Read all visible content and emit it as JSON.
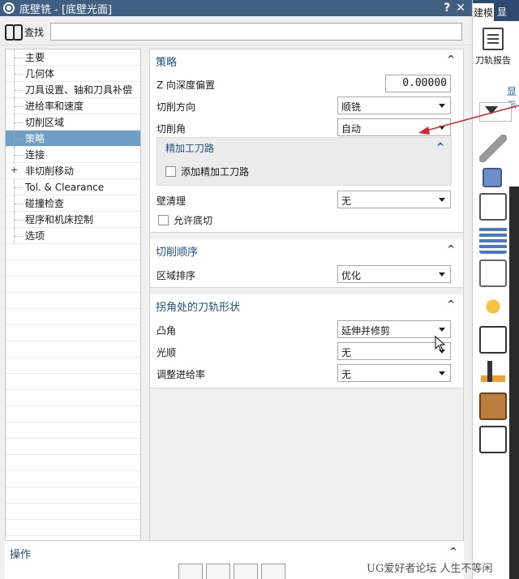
{
  "window": {
    "title": "底壁铣 - [底壁光面]",
    "help_label": "?",
    "close_label": "✕"
  },
  "search": {
    "label": "查找",
    "value": ""
  },
  "tree": {
    "items": [
      {
        "label": "主要",
        "expandable": false,
        "selected": false
      },
      {
        "label": "几何体",
        "expandable": false,
        "selected": false
      },
      {
        "label": "刀具设置、轴和刀具补偿",
        "expandable": false,
        "selected": false
      },
      {
        "label": "进给率和速度",
        "expandable": false,
        "selected": false
      },
      {
        "label": "切削区域",
        "expandable": false,
        "selected": false
      },
      {
        "label": "策略",
        "expandable": false,
        "selected": true
      },
      {
        "label": "连接",
        "expandable": false,
        "selected": false
      },
      {
        "label": "非切削移动",
        "expandable": true,
        "selected": false
      },
      {
        "label": "Tol. & Clearance",
        "expandable": false,
        "selected": false
      },
      {
        "label": "碰撞检查",
        "expandable": false,
        "selected": false
      },
      {
        "label": "程序和机床控制",
        "expandable": false,
        "selected": false
      },
      {
        "label": "选项",
        "expandable": false,
        "selected": false
      }
    ]
  },
  "strategy": {
    "title": "策略",
    "z_offset_label": "Z 向深度偏置",
    "z_offset_value": "0.00000",
    "cut_direction_label": "切削方向",
    "cut_direction_value": "顺铣",
    "cut_angle_label": "切削角",
    "cut_angle_value": "自动",
    "finish_title": "精加工刀路",
    "add_finish_label": "添加精加工刀路",
    "add_finish_checked": false,
    "wall_cleanup_label": "壁清理",
    "wall_cleanup_value": "无",
    "allow_undercut_label": "允许底切",
    "allow_undercut_checked": false
  },
  "cut_order": {
    "title": "切削顺序",
    "region_sort_label": "区域排序",
    "region_sort_value": "优化"
  },
  "corner": {
    "title": "拐角处的刀轨形状",
    "convex_label": "凸角",
    "convex_value": "延伸并修剪",
    "smooth_label": "光顺",
    "smooth_value": "无",
    "adjust_feed_label": "调整进给率",
    "adjust_feed_value": "无"
  },
  "operations": {
    "title": "操作"
  },
  "right_app": {
    "tab_label": "建模",
    "tab2_label": "显",
    "report_label": "刀轨报告",
    "show_label": "显示"
  },
  "watermark": "UG爱好者论坛 人生不等闲",
  "colors": {
    "titlebar": "#3f5e80",
    "selected_row": "#6f9ec6",
    "panel_title": "#1f4f80",
    "arrow": "#d9262a"
  },
  "icons": [
    "gear-icon",
    "binoculars-icon",
    "collapse-caret-icon",
    "dropdown-arrow-icon",
    "funnel-icon",
    "report-icon"
  ]
}
